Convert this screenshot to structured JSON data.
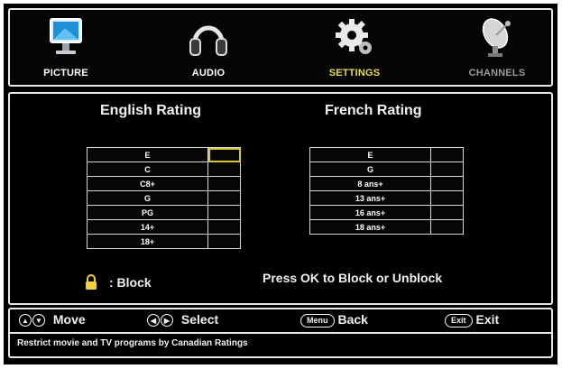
{
  "menu": {
    "items": [
      {
        "label": "PICTURE",
        "icon": "monitor-icon"
      },
      {
        "label": "AUDIO",
        "icon": "headphones-icon"
      },
      {
        "label": "SETTINGS",
        "icon": "gear-icon"
      },
      {
        "label": "CHANNELS",
        "icon": "satellite-dish-icon"
      }
    ],
    "active_color": "#e8dd3a"
  },
  "english": {
    "title": "English Rating",
    "rows": [
      "E",
      "C",
      "C8+",
      "G",
      "PG",
      "14+",
      "18+"
    ]
  },
  "french": {
    "title": "French Rating",
    "rows": [
      "E",
      "G",
      "8 ans+",
      "13 ans+",
      "16 ans+",
      "18 ans+"
    ]
  },
  "legend": {
    "text": ": Block"
  },
  "instruction": "Press OK to Block or Unblock",
  "hints": {
    "move": "Move",
    "select": "Select",
    "back_key": "Menu",
    "back": "Back",
    "exit_key": "Exit",
    "exit": "Exit"
  },
  "status": "Restrict movie and TV programs by Canadian Ratings"
}
